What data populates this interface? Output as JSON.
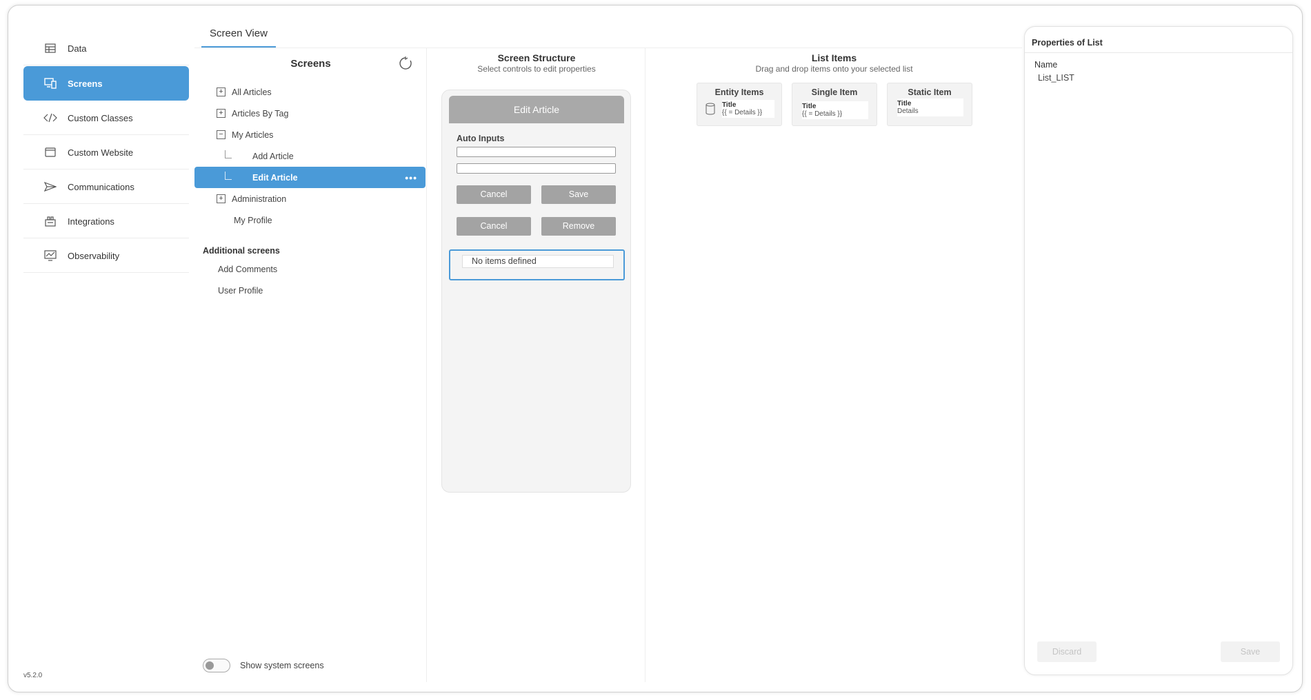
{
  "sidebar": {
    "items": [
      {
        "label": "Data",
        "icon": "table-icon"
      },
      {
        "label": "Screens",
        "icon": "devices-icon",
        "active": true
      },
      {
        "label": "Custom Classes",
        "icon": "code-icon"
      },
      {
        "label": "Custom Website",
        "icon": "browser-window-icon"
      },
      {
        "label": "Communications",
        "icon": "send-icon"
      },
      {
        "label": "Integrations",
        "icon": "plug-icon"
      },
      {
        "label": "Observability",
        "icon": "monitor-chart-icon"
      }
    ],
    "version": "v5.2.0"
  },
  "header": {
    "tab_label": "Screen View"
  },
  "screens": {
    "title": "Screens",
    "tree": [
      {
        "label": "All Articles",
        "box": "+"
      },
      {
        "label": "Articles By Tag",
        "box": "+"
      },
      {
        "label": "My Articles",
        "box": "−"
      },
      {
        "label": "Add Article"
      },
      {
        "label": "Edit Article",
        "selected": true,
        "more": "•••"
      },
      {
        "label": "Administration",
        "box": "+"
      },
      {
        "label": "My Profile"
      }
    ],
    "additional_label": "Additional screens",
    "additional": [
      {
        "label": "Add Comments"
      },
      {
        "label": "User Profile"
      }
    ],
    "toggle_label": "Show system screens"
  },
  "structure": {
    "title": "Screen Structure",
    "subtitle": "Select controls to edit properties",
    "phone_title": "Edit Article",
    "auto_inputs_label": "Auto Inputs",
    "cancel_label_1": "Cancel",
    "save_label": "Save",
    "cancel_label_2": "Cancel",
    "remove_label": "Remove",
    "list_placeholder": "No items defined"
  },
  "list_items": {
    "title": "List Items",
    "subtitle": "Drag and drop items onto your selected list",
    "cards": [
      {
        "title": "Entity Items",
        "line1": "Title",
        "line2": "{{ = Details }}"
      },
      {
        "title": "Single Item",
        "line1": "Title",
        "line2": "{{ = Details }}"
      },
      {
        "title": "Static Item",
        "line1": "Title",
        "line2": "Details"
      }
    ]
  },
  "properties": {
    "title": "Properties of List",
    "name_label": "Name",
    "name_value": "List_LIST",
    "discard_label": "Discard",
    "save_label": "Save"
  },
  "colors": {
    "accent": "#4a9ad8",
    "button_gray": "#a3a3a3"
  }
}
